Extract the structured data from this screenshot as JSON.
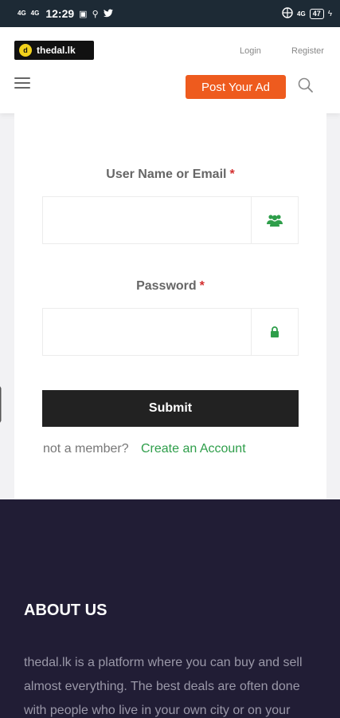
{
  "status_bar": {
    "net1": "4G",
    "net2": "4G",
    "time": "12:29",
    "icons_left": [
      "sim-icon",
      "usb-icon",
      "twitter-icon"
    ],
    "net_right": "4G",
    "battery": "47"
  },
  "header": {
    "logo_text": "thedal.lk",
    "login": "Login",
    "register": "Register",
    "post_ad": "Post Your Ad"
  },
  "form": {
    "username_label": "User Name or Email",
    "password_label": "Password",
    "required_mark": "*",
    "username_value": "",
    "password_value": "",
    "submit": "Submit",
    "not_member": "not a member?",
    "create_account": "Create an Account"
  },
  "footer": {
    "about_title": "ABOUT US",
    "about_text": "thedal.lk is a platform where you can buy and sell almost everything. The best deals are often done with people who live in your own city or on your"
  },
  "colors": {
    "accent_orange": "#ee5b1e",
    "green": "#2e9e4a",
    "footer_bg": "#211d35",
    "status_bg": "#1d2a35"
  }
}
